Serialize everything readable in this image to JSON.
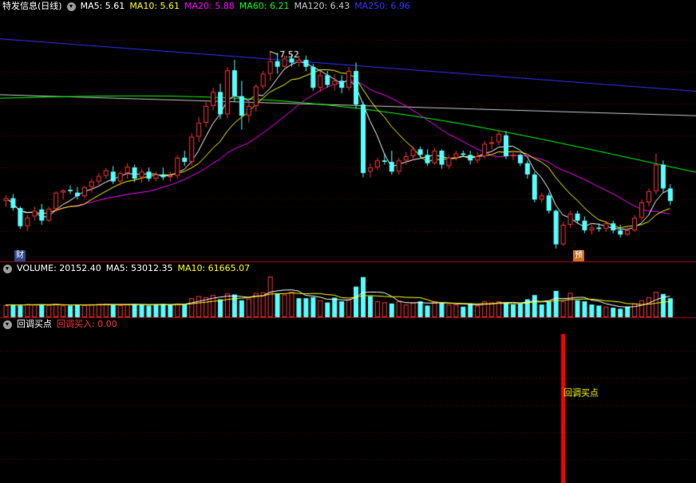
{
  "header": {
    "title": "特发信息(日线)",
    "ma": [
      {
        "label": "MA5: 5.61",
        "color": "#ffffff"
      },
      {
        "label": "MA10: 5.61",
        "color": "#ffff00"
      },
      {
        "label": "MA20: 5.88",
        "color": "#ff00ff"
      },
      {
        "label": "MA60: 6.21",
        "color": "#00ff00"
      },
      {
        "label": "MA120: 6.43",
        "color": "#c8c8c8"
      },
      {
        "label": "MA250: 6.96",
        "color": "#3333ff"
      }
    ]
  },
  "volume_header": {
    "label": "VOLUME: 20152.40",
    "ma5": "MA5: 53012.35",
    "ma10": "MA10: 61665.07"
  },
  "indicator_header": {
    "name": "回调买点",
    "value_label": "回调买入: 0.00"
  },
  "badges": {
    "left": "财",
    "right": "预"
  },
  "colors": {
    "up": "#ff3232",
    "down": "#54ffff",
    "ma5": "#ffffff",
    "ma10": "#ffff00",
    "ma20": "#ff00ff",
    "ma60": "#00ff00",
    "ma120": "#c8c8c8",
    "ma250": "#3333ff",
    "grid": "#7a0000",
    "signal": "#ff0000"
  },
  "chart_data": {
    "type": "candlestick",
    "high_annotation": "7.52",
    "price_range": [
      4.55,
      8.05
    ],
    "candles": [
      [
        5.38,
        5.46,
        5.3,
        5.42
      ],
      [
        5.42,
        5.48,
        5.24,
        5.28
      ],
      [
        5.28,
        5.3,
        4.98,
        5.02
      ],
      [
        5.02,
        5.18,
        4.95,
        5.14
      ],
      [
        5.16,
        5.3,
        5.1,
        5.24
      ],
      [
        5.26,
        5.34,
        5.04,
        5.1
      ],
      [
        5.1,
        5.3,
        5.08,
        5.27
      ],
      [
        5.27,
        5.52,
        5.22,
        5.5
      ],
      [
        5.5,
        5.55,
        5.4,
        5.53
      ],
      [
        5.54,
        5.6,
        5.48,
        5.52
      ],
      [
        5.5,
        5.58,
        5.4,
        5.45
      ],
      [
        5.45,
        5.6,
        5.42,
        5.58
      ],
      [
        5.58,
        5.7,
        5.5,
        5.66
      ],
      [
        5.66,
        5.78,
        5.6,
        5.74
      ],
      [
        5.74,
        5.85,
        5.7,
        5.82
      ],
      [
        5.8,
        5.88,
        5.62,
        5.66
      ],
      [
        5.66,
        5.8,
        5.6,
        5.78
      ],
      [
        5.78,
        5.92,
        5.7,
        5.87
      ],
      [
        5.86,
        5.9,
        5.65,
        5.7
      ],
      [
        5.72,
        5.84,
        5.64,
        5.8
      ],
      [
        5.8,
        5.86,
        5.66,
        5.7
      ],
      [
        5.7,
        5.8,
        5.66,
        5.76
      ],
      [
        5.76,
        5.86,
        5.68,
        5.72
      ],
      [
        5.72,
        5.8,
        5.66,
        5.74
      ],
      [
        5.74,
        6.04,
        5.7,
        6.0
      ],
      [
        6.0,
        6.1,
        5.88,
        5.94
      ],
      [
        5.94,
        6.35,
        5.88,
        6.3
      ],
      [
        6.3,
        6.58,
        6.22,
        6.5
      ],
      [
        6.5,
        6.8,
        6.44,
        6.74
      ],
      [
        6.74,
        7.0,
        6.68,
        6.94
      ],
      [
        6.94,
        7.06,
        6.55,
        6.62
      ],
      [
        6.62,
        7.3,
        6.56,
        7.25
      ],
      [
        7.25,
        7.4,
        6.8,
        6.88
      ],
      [
        6.88,
        7.1,
        6.4,
        6.6
      ],
      [
        6.6,
        6.8,
        6.5,
        6.74
      ],
      [
        6.74,
        7.05,
        6.66,
        7.02
      ],
      [
        7.02,
        7.24,
        6.98,
        7.2
      ],
      [
        7.2,
        7.52,
        7.1,
        7.38
      ],
      [
        7.38,
        7.5,
        7.2,
        7.3
      ],
      [
        7.3,
        7.46,
        7.28,
        7.42
      ],
      [
        7.42,
        7.48,
        7.3,
        7.36
      ],
      [
        7.36,
        7.46,
        7.3,
        7.4
      ],
      [
        7.4,
        7.46,
        7.24,
        7.3
      ],
      [
        7.3,
        7.34,
        6.96,
        7.0
      ],
      [
        7.0,
        7.24,
        6.94,
        7.18
      ],
      [
        7.18,
        7.24,
        7.0,
        7.04
      ],
      [
        7.04,
        7.2,
        6.96,
        7.1
      ],
      [
        7.1,
        7.18,
        6.92,
        7.0
      ],
      [
        7.0,
        7.3,
        6.96,
        7.24
      ],
      [
        7.24,
        7.36,
        6.7,
        6.76
      ],
      [
        6.76,
        6.8,
        5.72,
        5.78
      ],
      [
        5.8,
        5.92,
        5.72,
        5.86
      ],
      [
        5.86,
        6.0,
        5.82,
        5.96
      ],
      [
        5.96,
        6.06,
        5.9,
        5.94
      ],
      [
        5.94,
        6.1,
        5.76,
        5.8
      ],
      [
        5.8,
        6.0,
        5.76,
        5.96
      ],
      [
        5.96,
        6.08,
        5.9,
        6.02
      ],
      [
        6.02,
        6.16,
        5.98,
        6.12
      ],
      [
        6.12,
        6.16,
        6.0,
        6.04
      ],
      [
        6.04,
        6.12,
        5.88,
        5.92
      ],
      [
        5.92,
        6.14,
        5.9,
        6.1
      ],
      [
        6.1,
        6.12,
        5.84,
        5.9
      ],
      [
        5.88,
        6.04,
        5.84,
        6.0
      ],
      [
        6.0,
        6.1,
        5.96,
        6.06
      ],
      [
        6.06,
        6.1,
        6.02,
        6.04
      ],
      [
        6.04,
        6.1,
        5.9,
        5.96
      ],
      [
        5.96,
        6.08,
        5.92,
        6.02
      ],
      [
        6.02,
        6.24,
        5.98,
        6.2
      ],
      [
        6.2,
        6.3,
        6.12,
        6.22
      ],
      [
        6.22,
        6.4,
        6.18,
        6.34
      ],
      [
        6.32,
        6.38,
        5.98,
        6.02
      ],
      [
        6.02,
        6.1,
        5.96,
        6.04
      ],
      [
        6.04,
        6.06,
        5.88,
        5.92
      ],
      [
        5.92,
        5.96,
        5.7,
        5.76
      ],
      [
        5.76,
        5.8,
        5.36,
        5.4
      ],
      [
        5.4,
        5.5,
        5.36,
        5.46
      ],
      [
        5.46,
        5.5,
        5.2,
        5.24
      ],
      [
        5.24,
        5.26,
        4.7,
        4.76
      ],
      [
        4.76,
        5.08,
        4.74,
        5.04
      ],
      [
        5.04,
        5.24,
        5.0,
        5.2
      ],
      [
        5.2,
        5.24,
        5.06,
        5.1
      ],
      [
        5.1,
        5.16,
        4.92,
        4.96
      ],
      [
        4.96,
        5.06,
        4.9,
        5.0
      ],
      [
        5.0,
        5.06,
        4.94,
        4.98
      ],
      [
        4.98,
        5.1,
        4.94,
        5.06
      ],
      [
        5.06,
        5.1,
        4.92,
        4.96
      ],
      [
        4.96,
        5.04,
        4.86,
        4.9
      ],
      [
        4.9,
        5.0,
        4.88,
        4.96
      ],
      [
        4.96,
        5.18,
        4.94,
        5.14
      ],
      [
        5.14,
        5.4,
        5.1,
        5.36
      ],
      [
        5.36,
        5.56,
        5.3,
        5.52
      ],
      [
        5.52,
        6.06,
        5.48,
        5.9
      ],
      [
        5.9,
        5.96,
        5.5,
        5.56
      ],
      [
        5.56,
        5.62,
        5.32,
        5.38
      ]
    ],
    "ma120": [
      6.9,
      6.6
    ],
    "ma250": [
      7.7,
      6.95
    ],
    "volume": [
      [
        23,
        0
      ],
      [
        24,
        1
      ],
      [
        22,
        1
      ],
      [
        25,
        0
      ],
      [
        24,
        0
      ],
      [
        24,
        1
      ],
      [
        23,
        0
      ],
      [
        25,
        0
      ],
      [
        22,
        0
      ],
      [
        22,
        1
      ],
      [
        24,
        1
      ],
      [
        23,
        0
      ],
      [
        24,
        0
      ],
      [
        25,
        0
      ],
      [
        25,
        0
      ],
      [
        24,
        1
      ],
      [
        23,
        0
      ],
      [
        24,
        0
      ],
      [
        25,
        1
      ],
      [
        24,
        1
      ],
      [
        22,
        1
      ],
      [
        24,
        1
      ],
      [
        25,
        1
      ],
      [
        24,
        1
      ],
      [
        26,
        0
      ],
      [
        24,
        1
      ],
      [
        36,
        0
      ],
      [
        40,
        0
      ],
      [
        38,
        0
      ],
      [
        42,
        0
      ],
      [
        34,
        1
      ],
      [
        45,
        0
      ],
      [
        43,
        1
      ],
      [
        32,
        1
      ],
      [
        35,
        0
      ],
      [
        46,
        0
      ],
      [
        47,
        0
      ],
      [
        77,
        0
      ],
      [
        44,
        1
      ],
      [
        43,
        0
      ],
      [
        48,
        0
      ],
      [
        36,
        1
      ],
      [
        36,
        1
      ],
      [
        38,
        1
      ],
      [
        32,
        0
      ],
      [
        28,
        1
      ],
      [
        37,
        1
      ],
      [
        30,
        1
      ],
      [
        34,
        0
      ],
      [
        58,
        1
      ],
      [
        76,
        1
      ],
      [
        40,
        1
      ],
      [
        30,
        0
      ],
      [
        28,
        0
      ],
      [
        26,
        1
      ],
      [
        30,
        0
      ],
      [
        24,
        0
      ],
      [
        28,
        0
      ],
      [
        30,
        1
      ],
      [
        22,
        1
      ],
      [
        30,
        0
      ],
      [
        28,
        1
      ],
      [
        24,
        0
      ],
      [
        24,
        0
      ],
      [
        20,
        1
      ],
      [
        26,
        1
      ],
      [
        22,
        0
      ],
      [
        30,
        0
      ],
      [
        28,
        0
      ],
      [
        30,
        0
      ],
      [
        28,
        1
      ],
      [
        24,
        1
      ],
      [
        26,
        1
      ],
      [
        34,
        1
      ],
      [
        42,
        1
      ],
      [
        24,
        1
      ],
      [
        30,
        1
      ],
      [
        50,
        1
      ],
      [
        30,
        0
      ],
      [
        46,
        0
      ],
      [
        32,
        1
      ],
      [
        30,
        1
      ],
      [
        24,
        1
      ],
      [
        22,
        1
      ],
      [
        20,
        0
      ],
      [
        18,
        1
      ],
      [
        16,
        1
      ],
      [
        20,
        1
      ],
      [
        26,
        0
      ],
      [
        32,
        0
      ],
      [
        38,
        0
      ],
      [
        48,
        0
      ],
      [
        44,
        1
      ],
      [
        36,
        1
      ]
    ],
    "signal_index": 78,
    "signal_label": "回调买点"
  }
}
